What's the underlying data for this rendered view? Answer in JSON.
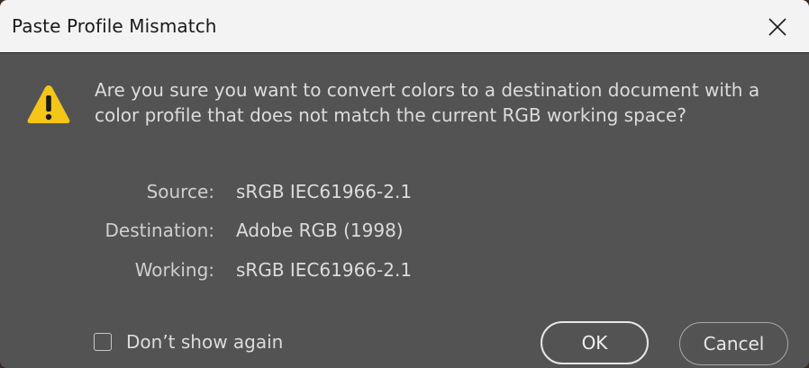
{
  "window": {
    "title": "Paste Profile Mismatch",
    "close_icon": "close-icon"
  },
  "message": {
    "icon": "warning-icon",
    "text": "Are you sure you want to convert colors to a destination document with a color profile that does not match the current RGB working space?"
  },
  "profiles": {
    "source_label": "Source:",
    "source_value": "sRGB IEC61966-2.1",
    "destination_label": "Destination:",
    "destination_value": "Adobe RGB (1998)",
    "working_label": "Working:",
    "working_value": "sRGB IEC61966-2.1"
  },
  "footer": {
    "dont_show_label": "Don’t show again",
    "dont_show_checked": false,
    "ok_label": "OK",
    "cancel_label": "Cancel"
  },
  "colors": {
    "dialog_bg": "#535353",
    "titlebar_bg": "#f3f3f3",
    "warning_yellow": "#f5c518"
  }
}
